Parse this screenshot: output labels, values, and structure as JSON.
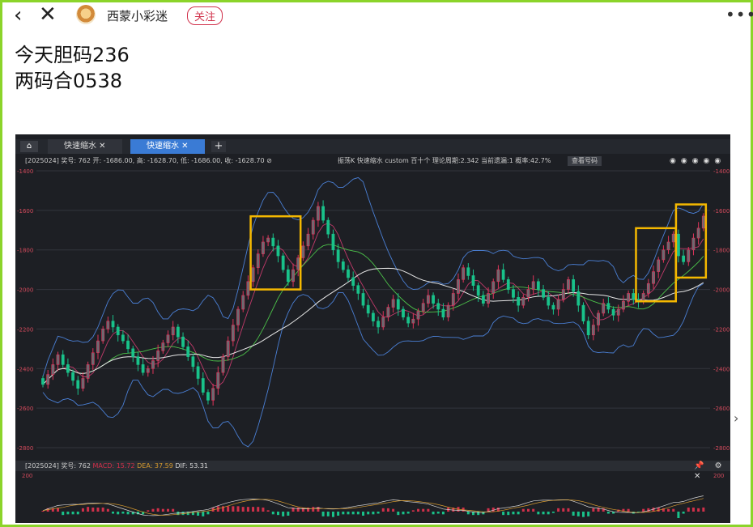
{
  "header": {
    "back_icon": "chevron-left-icon",
    "close_icon": "close-icon",
    "username": "西蒙小彩迷",
    "follow_label": "关注",
    "more_icon": "more-dots-icon"
  },
  "post": {
    "line1": "今天胆码236",
    "line2": "两码合0538"
  },
  "app": {
    "home_label": "⌂",
    "tabs": [
      {
        "label": "快速缩水"
      },
      {
        "label": "快速缩水"
      }
    ],
    "add_tab_label": "+",
    "info_left": "[2025024] 奖号: 762  开: -1686.00, 高: -1628.70, 低: -1686.00, 收: -1628.70 ⊘",
    "info_right": "振荡K  快速缩水  custom  百十个  理论周期:2.342  当前遗漏:1  概率:42.7%",
    "info_button": "查看号码",
    "macd_text_prefix": "[2025024] 奖号: 762 ",
    "macd_label": "MACD: 15.72",
    "dea_label": "DEA: 37.59",
    "dif_label": "DIF: 53.31",
    "macd_icons": "📌 ⚙ ✕"
  },
  "chart_data": {
    "type": "candlestick",
    "y_axis_ticks": [
      "-1400",
      "-1600",
      "-1800",
      "-2000",
      "-2200",
      "-2400",
      "-2600",
      "-2800"
    ],
    "ylim": [
      -2800,
      -1400
    ],
    "macd_axis_ticks": [
      "200"
    ],
    "series": [
      {
        "name": "close",
        "values": [
          -2480,
          -2430,
          -2380,
          -2330,
          -2380,
          -2420,
          -2460,
          -2500,
          -2450,
          -2380,
          -2320,
          -2260,
          -2200,
          -2160,
          -2190,
          -2230,
          -2260,
          -2300,
          -2340,
          -2380,
          -2420,
          -2400,
          -2360,
          -2310,
          -2270,
          -2230,
          -2190,
          -2240,
          -2290,
          -2340,
          -2390,
          -2450,
          -2520,
          -2560,
          -2500,
          -2420,
          -2340,
          -2260,
          -2180,
          -2100,
          -2030,
          -1960,
          -1890,
          -1820,
          -1760,
          -1740,
          -1780,
          -1830,
          -1900,
          -1960,
          -1900,
          -1840,
          -1780,
          -1720,
          -1650,
          -1580,
          -1650,
          -1720,
          -1800,
          -1860,
          -1900,
          -1940,
          -1980,
          -2020,
          -2080,
          -2120,
          -2160,
          -2190,
          -2140,
          -2090,
          -2050,
          -2100,
          -2140,
          -2170,
          -2150,
          -2110,
          -2070,
          -2030,
          -2070,
          -2100,
          -2140,
          -2080,
          -2020,
          -1950,
          -1890,
          -1930,
          -1980,
          -2030,
          -2070,
          -2020,
          -1960,
          -1900,
          -1950,
          -2000,
          -2040,
          -2080,
          -2040,
          -2000,
          -1960,
          -2000,
          -2040,
          -2080,
          -2100,
          -2050,
          -2000,
          -1950,
          -2010,
          -2080,
          -2160,
          -2230,
          -2180,
          -2120,
          -2070,
          -2100,
          -2130,
          -2100,
          -2060,
          -2020,
          -2050,
          -2060,
          -2020,
          -1970,
          -1910,
          -1850,
          -1800,
          -1760,
          -1720,
          -1830,
          -1860,
          -1800,
          -1740,
          -1690,
          -1629
        ]
      }
    ],
    "annotations": [
      "highlight-box-1",
      "highlight-box-2",
      "highlight-box-3"
    ]
  }
}
